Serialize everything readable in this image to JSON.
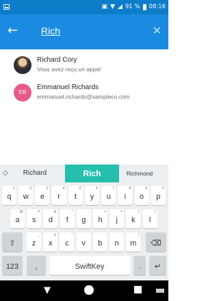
{
  "status": {
    "battery": "91 %",
    "time": "08:16"
  },
  "search": {
    "query": "Rich"
  },
  "results": [
    {
      "name": "Richard Cory",
      "subtitle": "Vous avez reçu un appel"
    },
    {
      "name": "Emmanuel Richards",
      "subtitle": "emmanuel.richards@xampleco.com",
      "initials": "ER"
    }
  ],
  "keyboard": {
    "suggestions": [
      "Richard",
      "Rich",
      "Richmond"
    ],
    "row1": [
      [
        "q",
        "1"
      ],
      [
        "w",
        "2"
      ],
      [
        "e",
        "3"
      ],
      [
        "r",
        "4"
      ],
      [
        "t",
        "5"
      ],
      [
        "y",
        "6"
      ],
      [
        "u",
        "7"
      ],
      [
        "i",
        "8"
      ],
      [
        "o",
        "9"
      ],
      [
        "p",
        "0"
      ]
    ],
    "row2": [
      [
        "a",
        "@"
      ],
      [
        "s",
        "#"
      ],
      [
        "d",
        "&"
      ],
      [
        "f",
        "*"
      ],
      [
        "g",
        "-"
      ],
      [
        "h",
        "+"
      ],
      [
        "j",
        "="
      ],
      [
        "k",
        "("
      ],
      [
        "l",
        ")"
      ]
    ],
    "row3": [
      [
        "z",
        "_"
      ],
      [
        "x",
        "£"
      ],
      [
        "c",
        "\""
      ],
      [
        "v",
        "'"
      ],
      [
        "b",
        ":"
      ],
      [
        "n",
        ";"
      ],
      [
        "m",
        "/"
      ]
    ],
    "bottom": {
      "numbers": "123",
      "comma": ",",
      "space": "SwiftKey",
      "period": "."
    }
  }
}
